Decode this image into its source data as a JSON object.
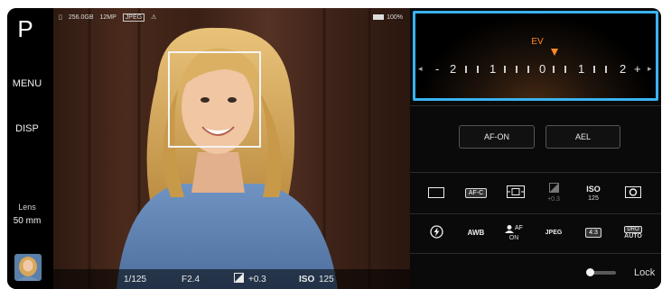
{
  "mode": "P",
  "left_rail": {
    "menu_label": "MENU",
    "disp_label": "DISP",
    "lens_label": "Lens",
    "lens_value": "50 mm"
  },
  "status_bar": {
    "storage": "256.0GB",
    "megapixels": "12MP",
    "format": "JPEG",
    "battery": "100%"
  },
  "viewfinder_info": {
    "shutter": "1/125",
    "aperture": "F2.4",
    "ev": "+0.3",
    "iso_label": "ISO",
    "iso": "125"
  },
  "ev_dial": {
    "label": "EV",
    "scale_labels": [
      "-",
      "2",
      "1",
      "0",
      "1",
      "2",
      "+"
    ],
    "value": 0.3,
    "range": [
      -2,
      2
    ]
  },
  "buttons": {
    "af_on": "AF-ON",
    "ael": "AEL"
  },
  "function_row1": [
    {
      "icon": "drive-single-icon",
      "text": ""
    },
    {
      "icon": "focus-mode-icon",
      "text": "AF-C"
    },
    {
      "icon": "focus-area-icon",
      "text": ""
    },
    {
      "icon": "exposure-comp-icon",
      "text": "+0.3"
    },
    {
      "icon": "iso-icon",
      "text": "ISO",
      "sub": "125"
    },
    {
      "icon": "metering-icon",
      "text": ""
    }
  ],
  "function_row2": [
    {
      "icon": "flash-icon",
      "text": ""
    },
    {
      "icon": "white-balance-icon",
      "text": "AWB"
    },
    {
      "icon": "face-eye-af-icon",
      "text": "AF",
      "sub": "ON"
    },
    {
      "icon": "file-format-icon",
      "text": "JPEG"
    },
    {
      "icon": "aspect-ratio-icon",
      "text": "4:3"
    },
    {
      "icon": "dro-icon",
      "text": "DRO",
      "sub": "AUTO"
    }
  ],
  "lock": {
    "label": "Lock",
    "enabled": false
  },
  "colors": {
    "accent_blue": "#39b3f0",
    "ev_orange": "#ff8a2a"
  }
}
